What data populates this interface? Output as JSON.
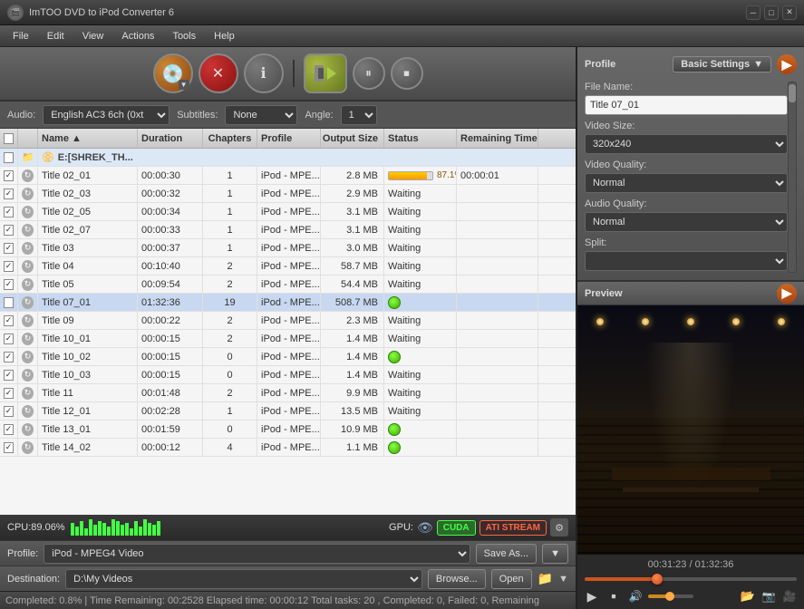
{
  "app": {
    "title": "ImTOO DVD to iPod Converter 6",
    "icon": "🎬"
  },
  "titleControls": {
    "minimize": "─",
    "maximize": "□",
    "close": "✕"
  },
  "menu": {
    "items": [
      "File",
      "Edit",
      "View",
      "Actions",
      "Tools",
      "Help"
    ]
  },
  "toolbar": {
    "addBtn": "＋",
    "stopBtn": "✕",
    "infoBtn": "ℹ",
    "convertBtn": "▶▶",
    "pauseBtn": "⏸",
    "stopBtn2": "⏹"
  },
  "controls": {
    "audioLabel": "Audio:",
    "audioValue": "English AC3 6ch (0xt",
    "subtitlesLabel": "Subtitles:",
    "subtitlesValue": "None",
    "angleLabel": "Angle:",
    "angleValue": "1"
  },
  "listHeader": {
    "name": "Name",
    "duration": "Duration",
    "chapters": "Chapters",
    "profile": "Profile",
    "outputSize": "Output Size",
    "status": "Status",
    "remainingTime": "Remaining Time"
  },
  "folderRow": {
    "name": "E:[SHREK_TH..."
  },
  "files": [
    {
      "checked": true,
      "name": "Title 02_01",
      "duration": "00:00:30",
      "chapters": "1",
      "profile": "iPod - MPE...",
      "size": "2.8 MB",
      "status": "87.1%",
      "progress": 87,
      "remaining": "00:00:01",
      "type": "progress"
    },
    {
      "checked": true,
      "name": "Title 02_03",
      "duration": "00:00:32",
      "chapters": "1",
      "profile": "iPod - MPE...",
      "size": "2.9 MB",
      "status": "Waiting",
      "remaining": "",
      "type": "waiting"
    },
    {
      "checked": true,
      "name": "Title 02_05",
      "duration": "00:00:34",
      "chapters": "1",
      "profile": "iPod - MPE...",
      "size": "3.1 MB",
      "status": "Waiting",
      "remaining": "",
      "type": "waiting"
    },
    {
      "checked": true,
      "name": "Title 02_07",
      "duration": "00:00:33",
      "chapters": "1",
      "profile": "iPod - MPE...",
      "size": "3.1 MB",
      "status": "Waiting",
      "remaining": "",
      "type": "waiting"
    },
    {
      "checked": true,
      "name": "Title 03",
      "duration": "00:00:37",
      "chapters": "1",
      "profile": "iPod - MPE...",
      "size": "3.0 MB",
      "status": "Waiting",
      "remaining": "",
      "type": "waiting"
    },
    {
      "checked": true,
      "name": "Title 04",
      "duration": "00:10:40",
      "chapters": "2",
      "profile": "iPod - MPE...",
      "size": "58.7 MB",
      "status": "Waiting",
      "remaining": "",
      "type": "waiting"
    },
    {
      "checked": true,
      "name": "Title 05",
      "duration": "00:09:54",
      "chapters": "2",
      "profile": "iPod - MPE...",
      "size": "54.4 MB",
      "status": "Waiting",
      "remaining": "",
      "type": "waiting"
    },
    {
      "checked": false,
      "name": "Title 07_01",
      "duration": "01:32:36",
      "chapters": "19",
      "profile": "iPod - MPE...",
      "size": "508.7 MB",
      "status": "done",
      "remaining": "",
      "type": "done",
      "selected": true
    },
    {
      "checked": true,
      "name": "Title 09",
      "duration": "00:00:22",
      "chapters": "2",
      "profile": "iPod - MPE...",
      "size": "2.3 MB",
      "status": "Waiting",
      "remaining": "",
      "type": "waiting"
    },
    {
      "checked": true,
      "name": "Title 10_01",
      "duration": "00:00:15",
      "chapters": "2",
      "profile": "iPod - MPE...",
      "size": "1.4 MB",
      "status": "Waiting",
      "remaining": "",
      "type": "waiting"
    },
    {
      "checked": true,
      "name": "Title 10_02",
      "duration": "00:00:15",
      "chapters": "0",
      "profile": "iPod - MPE...",
      "size": "1.4 MB",
      "status": "done",
      "remaining": "",
      "type": "done"
    },
    {
      "checked": true,
      "name": "Title 10_03",
      "duration": "00:00:15",
      "chapters": "0",
      "profile": "iPod - MPE...",
      "size": "1.4 MB",
      "status": "Waiting",
      "remaining": "",
      "type": "waiting"
    },
    {
      "checked": true,
      "name": "Title 11",
      "duration": "00:01:48",
      "chapters": "2",
      "profile": "iPod - MPE...",
      "size": "9.9 MB",
      "status": "Waiting",
      "remaining": "",
      "type": "waiting"
    },
    {
      "checked": true,
      "name": "Title 12_01",
      "duration": "00:02:28",
      "chapters": "1",
      "profile": "iPod - MPE...",
      "size": "13.5 MB",
      "status": "Waiting",
      "remaining": "",
      "type": "waiting"
    },
    {
      "checked": true,
      "name": "Title 13_01",
      "duration": "00:01:59",
      "chapters": "0",
      "profile": "iPod - MPE...",
      "size": "10.9 MB",
      "status": "done",
      "remaining": "",
      "type": "done"
    },
    {
      "checked": true,
      "name": "Title 14_02",
      "duration": "00:00:12",
      "chapters": "4",
      "profile": "iPod - MPE...",
      "size": "1.1 MB",
      "status": "done",
      "remaining": "",
      "type": "done"
    }
  ],
  "cpuBar": {
    "label": "CPU:89.06%",
    "gpuLabel": "GPU:",
    "cuda": "CUDA",
    "ati": "ATI STREAM"
  },
  "profileBar": {
    "label": "Profile:",
    "value": "iPod - MPEG4 Video",
    "saveAs": "Save As..."
  },
  "destBar": {
    "label": "Destination:",
    "value": "D:\\My Videos",
    "browse": "Browse...",
    "open": "Open"
  },
  "statusBar": {
    "text": "Completed: 0.8%  |  Time Remaining: 00:2528  Elapsed time: 00:00:12  Total tasks: 20 , Completed: 0, Failed: 0, Remaining"
  },
  "rightPanel": {
    "profileLabel": "Profile",
    "basicSettings": "Basic Settings",
    "fileNameLabel": "File Name:",
    "fileNameValue": "Title 07_01",
    "videoSizeLabel": "Video Size:",
    "videoSizeValue": "320x240",
    "videoQualityLabel": "Video Quality:",
    "videoQualityValue": "Normal",
    "audioQualityLabel": "Audio Quality:",
    "audioQualityValue": "Normal",
    "splitLabel": "Split:"
  },
  "previewPanel": {
    "label": "Preview",
    "timeDisplay": "00:31:23 / 01:32:36",
    "sliderPercent": 34
  }
}
